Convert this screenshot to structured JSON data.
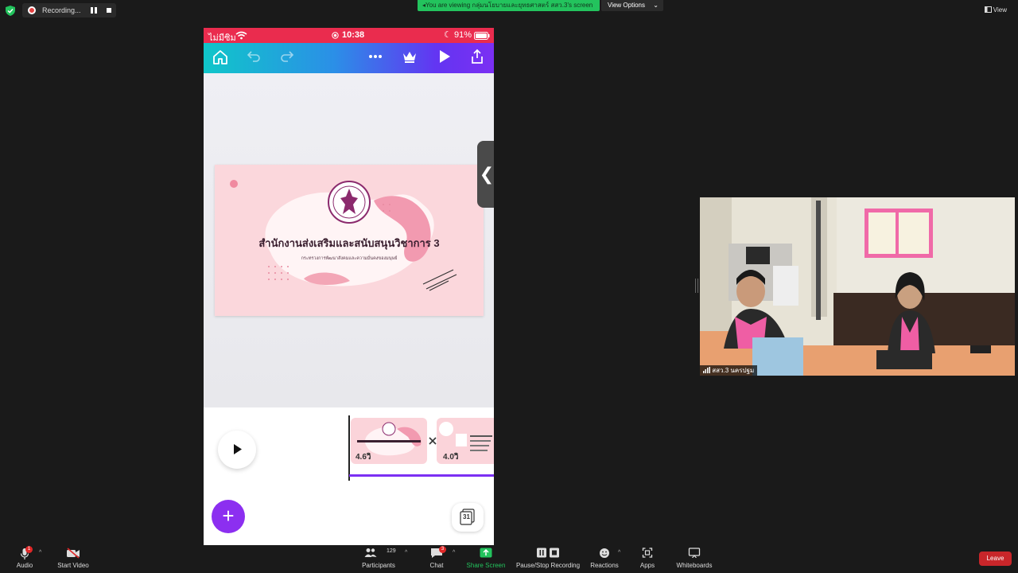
{
  "top": {
    "recording_label": "Recording...",
    "viewing_label": "You are viewing กลุ่มนโยบายและยุทธศาสตร์ สสว.3's screen",
    "view_options_label": "View Options",
    "view_label": "View"
  },
  "phone": {
    "carrier": "ไม่มีซิม",
    "time": "10:38",
    "battery": "91%",
    "slide_title": "สำนักงานส่งเสริมและสนับสนุนวิชาการ 3",
    "slide_subtitle": "กระทรวงการพัฒนาสังคมและความมั่นคงของมนุษย์",
    "thumb1_duration": "4.6วิ",
    "thumb2_duration": "4.0วิ",
    "pages_count": "31",
    "side_tab_glyph": "❮",
    "fab_glyph": "+"
  },
  "camera": {
    "label": "สสว.3 นครปฐม"
  },
  "toolbar": {
    "audio": "Audio",
    "audio_badge": "1",
    "start_video": "Start Video",
    "participants": "Participants",
    "participants_count": "129",
    "chat": "Chat",
    "chat_badge": "3",
    "share_screen": "Share Screen",
    "pause_stop_recording": "Pause/Stop Recording",
    "reactions": "Reactions",
    "apps": "Apps",
    "whiteboards": "Whiteboards",
    "leave": "Leave"
  },
  "colors": {
    "share_green": "#23c35d",
    "leave_red": "#c8262a",
    "canva_purple": "#7b2ff3",
    "status_red": "#ea2c4e"
  }
}
